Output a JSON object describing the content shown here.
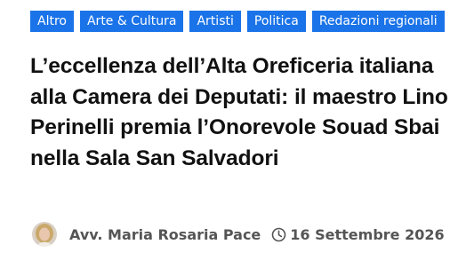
{
  "tags": [
    "Altro",
    "Arte & Cultura",
    "Artisti",
    "Politica",
    "Redazioni regionali"
  ],
  "article": {
    "title": "L’eccellenza dell’Alta Oreficeria italiana alla Camera dei Deputati: il maestro Lino Perinelli premia l’Onorevole Souad Sbai nella Sala San Salvadori"
  },
  "meta": {
    "author": "Avv. Maria Rosaria Pace",
    "date": "16 Settembre 2026",
    "avatar_icon": "author-avatar",
    "date_icon": "clock-icon"
  },
  "colors": {
    "tag_background": "#1a73e8",
    "tag_text": "#ffffff",
    "title": "#111111",
    "meta_text": "#555555"
  }
}
